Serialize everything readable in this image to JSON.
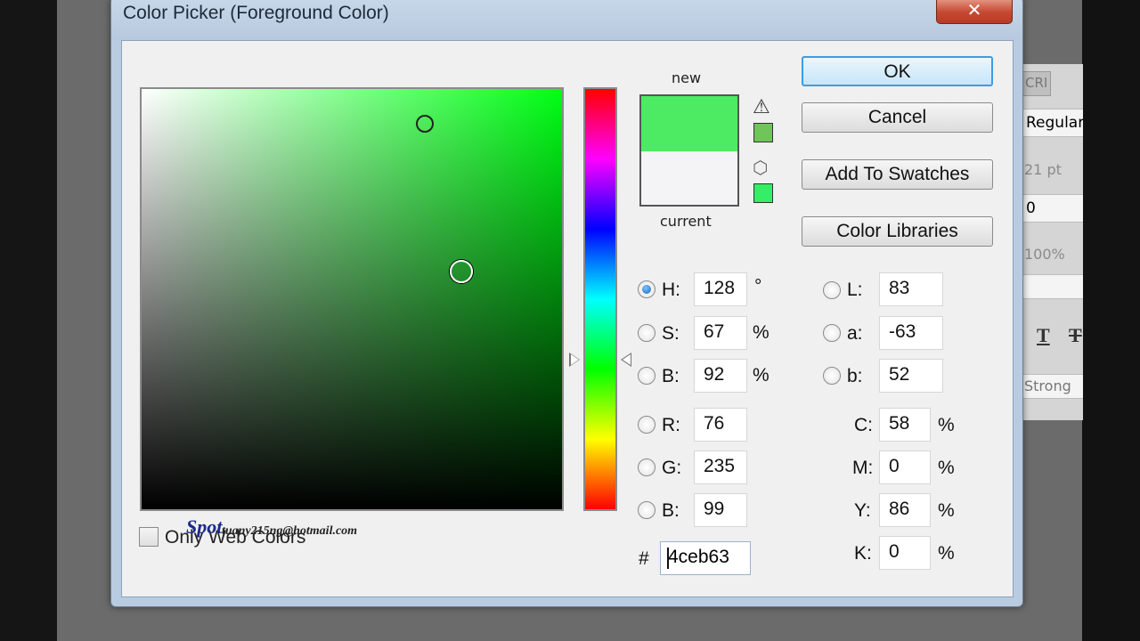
{
  "background_panel": {
    "tab_label": "CRI",
    "font_style": "Regular",
    "font_size": "21 pt",
    "field_value": "0",
    "percent": "100%",
    "text_style_icons": [
      "T",
      "T"
    ],
    "antialias": "Strong"
  },
  "dialog": {
    "title": "Color Picker (Foreground Color)",
    "close_label": "✕",
    "preview": {
      "new_label": "new",
      "current_label": "current",
      "new_color": "#4ceb63",
      "current_color": "#f4f4f6",
      "gamut_warning_color": "#6fc45a",
      "web_safe_color": "#33ee66",
      "warning_icon": "⚠",
      "cube_icon": "⬡"
    },
    "buttons": {
      "ok": "OK",
      "cancel": "Cancel",
      "add_to_swatches": "Add To Swatches",
      "color_libraries": "Color Libraries"
    },
    "hsb": {
      "h": {
        "label": "H:",
        "value": "128",
        "unit": "°",
        "selected": true
      },
      "s": {
        "label": "S:",
        "value": "67",
        "unit": "%"
      },
      "b": {
        "label": "B:",
        "value": "92",
        "unit": "%"
      }
    },
    "rgb": {
      "r": {
        "label": "R:",
        "value": "76"
      },
      "g": {
        "label": "G:",
        "value": "235"
      },
      "b": {
        "label": "B:",
        "value": "99"
      }
    },
    "lab": {
      "l": {
        "label": "L:",
        "value": "83"
      },
      "a": {
        "label": "a:",
        "value": "-63"
      },
      "b": {
        "label": "b:",
        "value": "52"
      }
    },
    "cmyk": {
      "c": {
        "label": "C:",
        "value": "58",
        "unit": "%"
      },
      "m": {
        "label": "M:",
        "value": "0",
        "unit": "%"
      },
      "y": {
        "label": "Y:",
        "value": "86",
        "unit": "%"
      },
      "k": {
        "label": "K:",
        "value": "0",
        "unit": "%"
      }
    },
    "hex": {
      "label": "#",
      "value": "4ceb63"
    },
    "only_web_colors": {
      "label": "Only Web Colors",
      "checked": false
    },
    "watermark": {
      "logo": "Spot",
      "email": "tuany215ng@hotmail.com"
    }
  }
}
